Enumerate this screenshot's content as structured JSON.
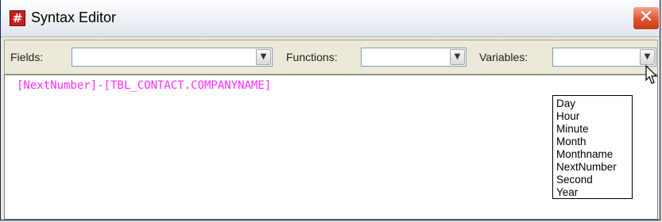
{
  "window": {
    "title": "Syntax Editor",
    "icon": "app-icon",
    "close_glyph": "✕"
  },
  "toolbar": {
    "fields": {
      "label": "Fields:",
      "value": ""
    },
    "functions": {
      "label": "Functions:",
      "value": ""
    },
    "variables": {
      "label": "Variables:",
      "value": ""
    }
  },
  "editor": {
    "content": "[NextNumber]-[TBL_CONTACT.COMPANYNAME]",
    "text_color": "#ff2bff"
  },
  "variables_dropdown": {
    "open": true,
    "options": [
      "Day",
      "Hour",
      "Minute",
      "Month",
      "Monthname",
      "NextNumber",
      "Second",
      "Year"
    ]
  }
}
